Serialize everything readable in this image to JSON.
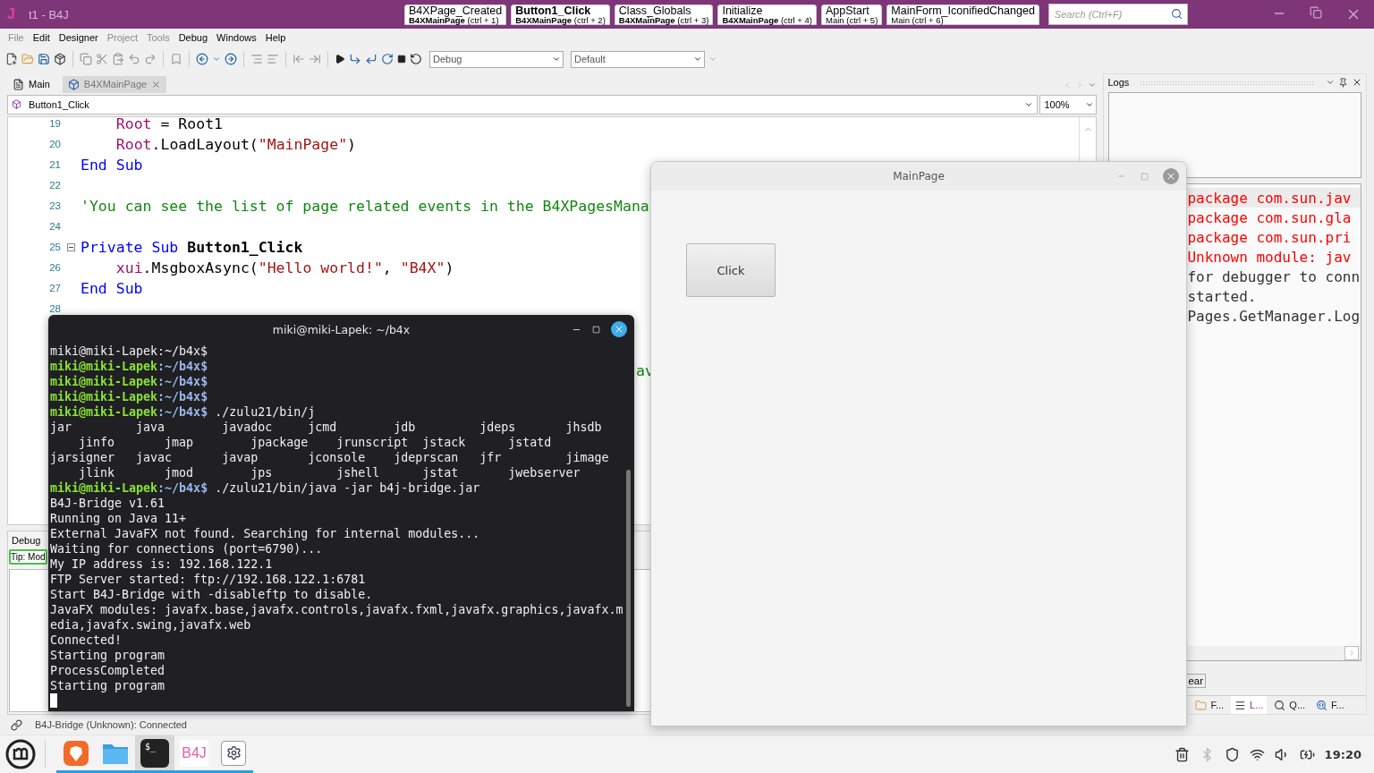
{
  "window": {
    "app_icon": "J",
    "title": "t1 - B4J"
  },
  "quick_tabs": [
    {
      "title": "B4XPage_Created",
      "module": "B4XMainPage",
      "shortcut": "(ctrl + 1)",
      "selected": false,
      "emphasized": true
    },
    {
      "title": "Button1_Click",
      "module": "B4XMainPage",
      "shortcut": "(ctrl + 2)",
      "selected": true,
      "emphasized": true
    },
    {
      "title": "Class_Globals",
      "module": "B4XMainPage",
      "shortcut": "(ctrl + 3)",
      "selected": false,
      "emphasized": true
    },
    {
      "title": "Initialize",
      "module": "B4XMainPage",
      "shortcut": "(ctrl + 4)",
      "selected": false,
      "emphasized": true
    },
    {
      "title": "AppStart",
      "module": "Main",
      "shortcut": "(ctrl + 5)",
      "selected": false,
      "emphasized": false
    },
    {
      "title": "MainForm_IconifiedChanged",
      "module": "Main",
      "shortcut": "(ctrl + 6)",
      "selected": false,
      "emphasized": false
    }
  ],
  "search": {
    "placeholder": "Search (Ctrl+F)"
  },
  "menu": [
    {
      "label": "File",
      "disabled": true
    },
    {
      "label": "Edit",
      "disabled": false
    },
    {
      "label": "Designer",
      "disabled": false
    },
    {
      "label": "Project",
      "disabled": true
    },
    {
      "label": "Tools",
      "disabled": true
    },
    {
      "label": "Debug",
      "disabled": false
    },
    {
      "label": "Windows",
      "disabled": false
    },
    {
      "label": "Help",
      "disabled": false
    }
  ],
  "toolbar": {
    "build_mode": "Debug",
    "config": "Default"
  },
  "doc_tabs": [
    {
      "label": "Main",
      "kind": "main",
      "selected": false,
      "closable": false
    },
    {
      "label": "B4XMainPage",
      "kind": "class",
      "selected": true,
      "closable": true
    }
  ],
  "sub_selector": {
    "value": "Button1_Click",
    "zoom": "100%"
  },
  "code_lines": [
    {
      "number": "19",
      "indent": true,
      "segments": [
        {
          "kind": "ident",
          "text": "Root"
        },
        {
          "kind": "plain",
          "text": " = Root1"
        }
      ]
    },
    {
      "number": "20",
      "indent": true,
      "segments": [
        {
          "kind": "ident",
          "text": "Root"
        },
        {
          "kind": "plain",
          "text": ".LoadLayout("
        },
        {
          "kind": "string",
          "text": "\"MainPage\""
        },
        {
          "kind": "plain",
          "text": ")"
        }
      ]
    },
    {
      "number": "21",
      "segments": [
        {
          "kind": "keyword",
          "text": "End Sub"
        }
      ]
    },
    {
      "number": "22"
    },
    {
      "number": "23",
      "segments": [
        {
          "kind": "comment",
          "text": "'You can see the list of page related events in the B4XPagesMana"
        }
      ]
    },
    {
      "number": "24"
    },
    {
      "number": "25",
      "fold": true,
      "segments": [
        {
          "kind": "keyword",
          "text": "Private Sub "
        },
        {
          "kind": "bold",
          "text": "Button1_Click"
        }
      ]
    },
    {
      "number": "26",
      "indent": true,
      "segments": [
        {
          "kind": "ident",
          "text": "xui"
        },
        {
          "kind": "plain",
          "text": ".MsgboxAsync("
        },
        {
          "kind": "string",
          "text": "\"Hello world!\""
        },
        {
          "kind": "plain",
          "text": ", "
        },
        {
          "kind": "string",
          "text": "\"B4X\""
        },
        {
          "kind": "plain",
          "text": ")"
        }
      ]
    },
    {
      "number": "27",
      "segments": [
        {
          "kind": "keyword",
          "text": "End Sub"
        }
      ]
    },
    {
      "number": "28"
    }
  ],
  "code_tail": "av",
  "debug_panel": {
    "tab": "Debug",
    "tip": "Tip: Mod"
  },
  "logs": {
    "title": "Logs",
    "rows": [
      {
        "kind": "error",
        "text": "package com.sun.jav",
        "selected": true
      },
      {
        "kind": "error",
        "text": "package com.sun.gla",
        "selected": false
      },
      {
        "kind": "error",
        "text": "package com.sun.pri",
        "selected": false
      },
      {
        "kind": "error",
        "text": "Unknown module: jav",
        "selected": false
      },
      {
        "kind": "info",
        "text": "for debugger to conn",
        "selected": false
      },
      {
        "kind": "info",
        "text": "started.",
        "selected": false
      },
      {
        "kind": "info",
        "text": "Pages.GetManager.Log",
        "selected": false
      }
    ],
    "clear_button": "ear",
    "tabs": [
      {
        "kind": "files",
        "label": "F...",
        "selected": false
      },
      {
        "kind": "logs",
        "label": "L...",
        "selected": true
      },
      {
        "kind": "quick",
        "label": "Q...",
        "selected": false
      },
      {
        "kind": "find",
        "label": "F...",
        "selected": false
      }
    ]
  },
  "status_bar": {
    "text": "B4J-Bridge (Unknown): Connected"
  },
  "terminal": {
    "title": "miki@miki-Lapek: ~/b4x",
    "lines": [
      {
        "kind": "plain",
        "text": "miki@miki-Lapek:~/b4x$"
      },
      {
        "kind": "prompt",
        "user": "miki@miki-Lapek",
        "path": ":~/b4x$"
      },
      {
        "kind": "prompt",
        "user": "miki@miki-Lapek",
        "path": ":~/b4x$"
      },
      {
        "kind": "prompt",
        "user": "miki@miki-Lapek",
        "path": ":~/b4x$"
      },
      {
        "kind": "prompt",
        "user": "miki@miki-Lapek",
        "path": ":~/b4x$",
        "command": " ./zulu21/bin/j"
      },
      {
        "kind": "plain",
        "text": "jar         java        javadoc     jcmd        jdb         jdeps       jhsdb"
      },
      {
        "kind": "plain",
        "text": "    jinfo       jmap        jpackage    jrunscript  jstack      jstatd"
      },
      {
        "kind": "plain",
        "text": "jarsigner   javac       javap       jconsole    jdeprscan   jfr         jimage"
      },
      {
        "kind": "plain",
        "text": "    jlink       jmod        jps         jshell      jstat       jwebserver"
      },
      {
        "kind": "prompt",
        "user": "miki@miki-Lapek",
        "path": ":~/b4x$",
        "command": " ./zulu21/bin/java -jar b4j-bridge.jar"
      },
      {
        "kind": "plain",
        "text": "B4J-Bridge v1.61"
      },
      {
        "kind": "plain",
        "text": "Running on Java 11+"
      },
      {
        "kind": "plain",
        "text": "External JavaFX not found. Searching for internal modules..."
      },
      {
        "kind": "plain",
        "text": "Waiting for connections (port=6790)..."
      },
      {
        "kind": "plain",
        "text": "My IP address is: 192.168.122.1"
      },
      {
        "kind": "plain",
        "text": "FTP Server started: ftp://192.168.122.1:6781"
      },
      {
        "kind": "plain",
        "text": "Start B4J-Bridge with -disableftp to disable."
      },
      {
        "kind": "plain",
        "text": "JavaFX modules: javafx.base,javafx.controls,javafx.fxml,javafx.graphics,javafx.m"
      },
      {
        "kind": "plain",
        "text": "edia,javafx.swing,javafx.web"
      },
      {
        "kind": "plain",
        "text": "Connected!"
      },
      {
        "kind": "plain",
        "text": "Starting program"
      },
      {
        "kind": "plain",
        "text": "ProcessCompleted"
      },
      {
        "kind": "plain",
        "text": "Starting program"
      },
      {
        "kind": "cursor"
      }
    ]
  },
  "app_window": {
    "title": "MainPage",
    "button": "Click"
  },
  "taskbar": {
    "apps": [
      {
        "kind": "browser",
        "selected": false
      },
      {
        "kind": "files",
        "selected": false
      },
      {
        "kind": "terminal",
        "glyph": "$_",
        "selected": true
      },
      {
        "kind": "b4j",
        "glyph": "B4J",
        "selected": false
      },
      {
        "kind": "settings",
        "selected": false
      }
    ],
    "tray": [
      {
        "kind": "trash",
        "disabled": false
      },
      {
        "kind": "bluetooth",
        "disabled": true
      },
      {
        "kind": "shield",
        "disabled": false
      },
      {
        "kind": "wifi",
        "disabled": false
      },
      {
        "kind": "volume",
        "disabled": false
      },
      {
        "kind": "battery",
        "disabled": false
      }
    ],
    "clock": "19:20"
  }
}
